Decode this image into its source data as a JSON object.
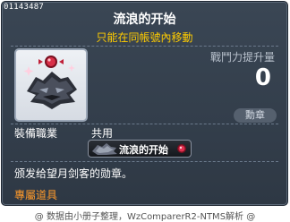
{
  "tooltip": {
    "item_id": "01143487",
    "title": "流浪的开始",
    "restriction": "只能在同帳號內移動",
    "combat_power_label": "戰鬥力提升量",
    "combat_power_value": "0",
    "category": "勳章",
    "job_label": "裝備職業",
    "job_value": "共用",
    "badge_text": "流浪的开始",
    "description": "颁发给望月剑客的勋章。",
    "exclusive": "專屬道具"
  },
  "credit": "@ 数据由小册子整理，WzComparerR2-NTMS解析 @",
  "icons": {
    "medal": "wolf-head-medal-icon",
    "gem": "red-gem-icon"
  },
  "colors": {
    "restriction": "#ffcc00",
    "exclusive": "#ff9a2a",
    "background": "#353f4b"
  }
}
